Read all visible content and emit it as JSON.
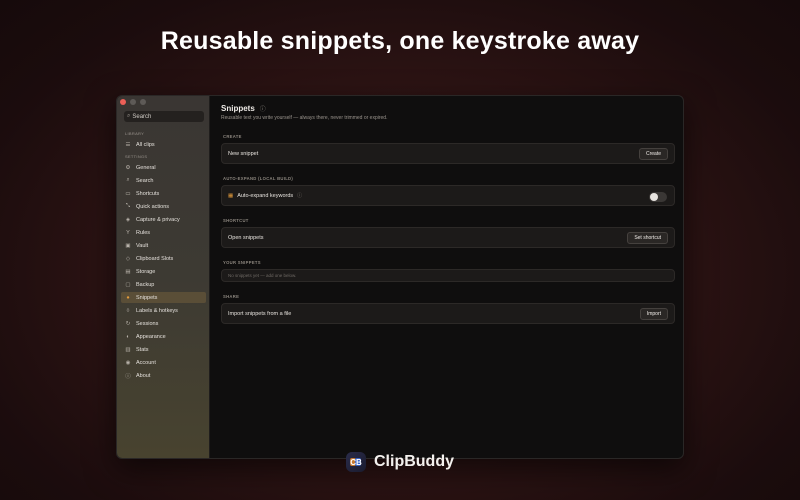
{
  "hero": {
    "title": "Reusable snippets, one keystroke away"
  },
  "sidebar": {
    "search_placeholder": "Search",
    "library_label": "LIBRARY",
    "settings_label": "SETTINGS",
    "library_items": [
      {
        "label": "All clips",
        "icon": "list-icon"
      }
    ],
    "items": [
      {
        "label": "General",
        "icon": "gear-icon"
      },
      {
        "label": "Search",
        "icon": "search-icon"
      },
      {
        "label": "Shortcuts",
        "icon": "keyboard-icon"
      },
      {
        "label": "Quick actions",
        "icon": "wand-icon"
      },
      {
        "label": "Capture & privacy",
        "icon": "shield-icon"
      },
      {
        "label": "Rules",
        "icon": "branch-icon"
      },
      {
        "label": "Vault",
        "icon": "lock-icon"
      },
      {
        "label": "Clipboard Slots",
        "icon": "layers-icon"
      },
      {
        "label": "Storage",
        "icon": "storage-icon"
      },
      {
        "label": "Backup",
        "icon": "backup-icon"
      },
      {
        "label": "Snippets",
        "icon": "snippet-icon"
      },
      {
        "label": "Labels & hotkeys",
        "icon": "tag-icon"
      },
      {
        "label": "Sessions",
        "icon": "refresh-icon"
      },
      {
        "label": "Appearance",
        "icon": "palette-icon"
      },
      {
        "label": "Stats",
        "icon": "chart-icon"
      },
      {
        "label": "Account",
        "icon": "user-icon"
      },
      {
        "label": "About",
        "icon": "info-icon"
      }
    ],
    "active_item": "Snippets"
  },
  "main": {
    "title": "Snippets",
    "subtitle": "Reusable text you write yourself — always there, never trimmed or expired.",
    "create": {
      "heading": "CREATE",
      "label": "New snippet",
      "button": "Create"
    },
    "autoexpand": {
      "heading": "AUTO-EXPAND (LOCAL BUILD)",
      "label": "Auto-expand keywords",
      "toggle_on": false
    },
    "shortcut": {
      "heading": "SHORTCUT",
      "label": "Open snippets",
      "button": "Set shortcut"
    },
    "your_snippets": {
      "heading": "YOUR SNIPPETS",
      "empty_text": "No snippets yet — add one below."
    },
    "share": {
      "heading": "SHARE",
      "label": "Import snippets from a file",
      "button": "Import"
    }
  },
  "brand": {
    "name": "ClipBuddy",
    "logo_text": "CB"
  },
  "colors": {
    "accent": "#e29a3b",
    "close": "#ec5f57"
  }
}
